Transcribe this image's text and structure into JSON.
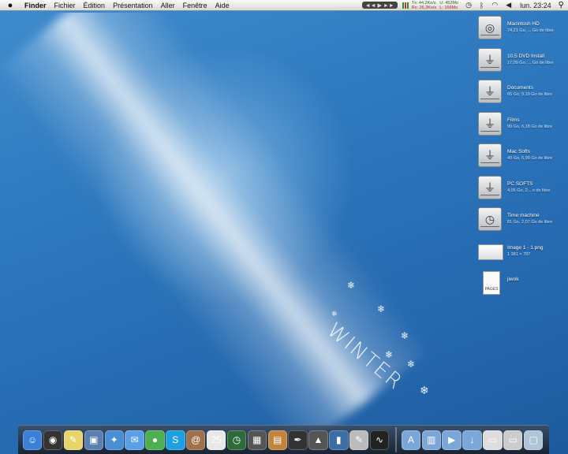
{
  "menubar": {
    "app": "Finder",
    "menus": [
      "Fichier",
      "Édition",
      "Présentation",
      "Aller",
      "Fenêtre",
      "Aide"
    ],
    "media_controls": "◄◄ ▶ ►►",
    "net_tx": "Tx: 44,2Ko/s",
    "net_rx": "Rx: 26,3Ko/s",
    "mem_u": "U: 452Mo",
    "mem_l": "L: 166Mo",
    "clock": "lun. 23:24"
  },
  "desktop": {
    "wallpaper_text": "WINTER",
    "icons": [
      {
        "name": "Macintosh HD",
        "info": "74,21 Go, ... Go de libre",
        "kind": "hdd"
      },
      {
        "name": "10.5 DVD Install",
        "info": "17,09 Go, ... Go de libre",
        "kind": "usb"
      },
      {
        "name": "Documents",
        "info": "65 Go, 9,19 Go de libre",
        "kind": "usb"
      },
      {
        "name": "Films",
        "info": "90 Go, 6,18 Go de libre",
        "kind": "usb"
      },
      {
        "name": "Mac Softs",
        "info": "40 Go, 6,99 Go de libre",
        "kind": "usb"
      },
      {
        "name": "PC SOFTS",
        "info": "4,05 Go, 2... o de libre",
        "kind": "usb"
      },
      {
        "name": "Time machine",
        "info": "81 Go, 2,07 Go de libre",
        "kind": "timemachine"
      },
      {
        "name": "Image 1 - 1.png",
        "info": "1 381 × 787",
        "kind": "image"
      },
      {
        "name": "jiwok",
        "info": "",
        "kind": "pages",
        "badge": "PAGES"
      }
    ]
  },
  "dock": {
    "items": [
      {
        "name": "finder",
        "glyph": "☺",
        "color": "#3b7fd6"
      },
      {
        "name": "dashboard",
        "glyph": "◉",
        "color": "#333"
      },
      {
        "name": "stickies",
        "glyph": "✎",
        "color": "#e8d46a"
      },
      {
        "name": "preview",
        "glyph": "▣",
        "color": "#5a7fb0"
      },
      {
        "name": "safari",
        "glyph": "✦",
        "color": "#4a8ed6"
      },
      {
        "name": "ichat",
        "glyph": "✉",
        "color": "#5aa0e6"
      },
      {
        "name": "adium",
        "glyph": "●",
        "color": "#4caf50"
      },
      {
        "name": "skype",
        "glyph": "S",
        "color": "#1ea0e0"
      },
      {
        "name": "address-book",
        "glyph": "@",
        "color": "#a0704a"
      },
      {
        "name": "ical",
        "glyph": "25",
        "color": "#e8e8e8"
      },
      {
        "name": "time-machine",
        "glyph": "◷",
        "color": "#2e6b3a"
      },
      {
        "name": "photo-booth",
        "glyph": "▦",
        "color": "#555"
      },
      {
        "name": "iphoto",
        "glyph": "▤",
        "color": "#c0843c"
      },
      {
        "name": "aperture",
        "glyph": "✒",
        "color": "#333"
      },
      {
        "name": "keynote",
        "glyph": "▲",
        "color": "#555"
      },
      {
        "name": "numbers",
        "glyph": "▮",
        "color": "#3a6ea5"
      },
      {
        "name": "textedit",
        "glyph": "✎",
        "color": "#bbb"
      },
      {
        "name": "activity-monitor",
        "glyph": "∿",
        "color": "#222"
      }
    ],
    "right_items": [
      {
        "name": "applications-folder",
        "glyph": "A",
        "color": "#7aa7d8"
      },
      {
        "name": "documents-folder",
        "glyph": "▥",
        "color": "#7aa7d8"
      },
      {
        "name": "movies-folder",
        "glyph": "▶",
        "color": "#7aa7d8"
      },
      {
        "name": "downloads-folder",
        "glyph": "↓",
        "color": "#7aa7d8"
      },
      {
        "name": "window-stack",
        "glyph": "▭",
        "color": "#ddd"
      },
      {
        "name": "screenshot",
        "glyph": "▭",
        "color": "#ccc"
      },
      {
        "name": "trash",
        "glyph": "▢",
        "color": "#b0c4d8"
      }
    ]
  }
}
